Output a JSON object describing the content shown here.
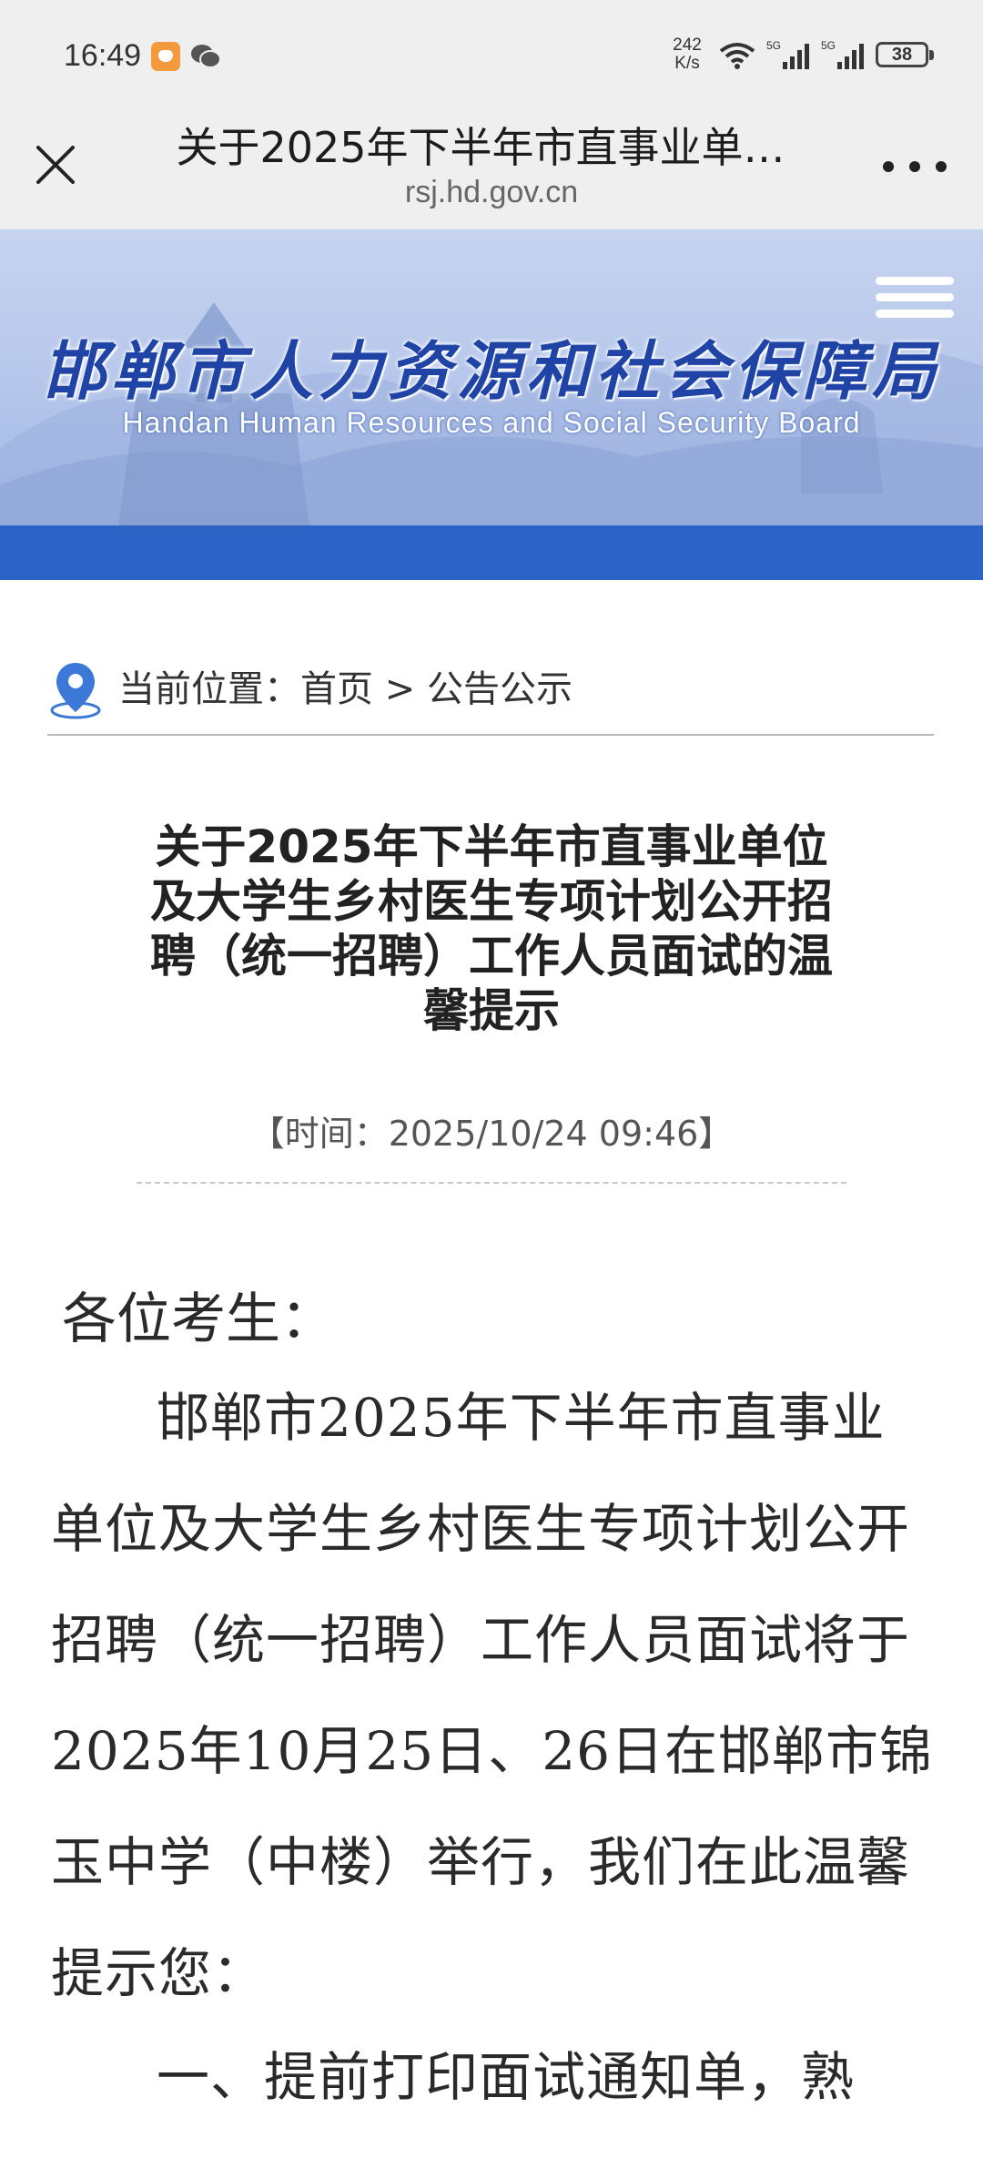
{
  "status_bar": {
    "time": "16:49",
    "net_speed_value": "242",
    "net_speed_unit": "K/s",
    "battery": "38",
    "icons": [
      "taobao-app-icon",
      "wechat-icon",
      "wifi-icon",
      "signal-5g-icon",
      "signal-5g-icon",
      "battery-icon"
    ]
  },
  "browser": {
    "title": "关于2025年下半年市直事业单…",
    "domain": "rsj.hd.gov.cn"
  },
  "banner": {
    "title_cn": "邯郸市人力资源和社会保障局",
    "title_en": "Handan Human Resources and Social Security Board"
  },
  "breadcrumb": {
    "text": "当前位置：首页 > 公告公示"
  },
  "article": {
    "title": "关于2025年下半年市直事业单位及大学生乡村医生专项计划公开招聘（统一招聘）工作人员面试的温馨提示",
    "time": "【时间：2025/10/24 09:46】",
    "salutation": "各位考生：",
    "paragraph1": "邯郸市2025年下半年市直事业单位及大学生乡村医生专项计划公开招聘（统一招聘）工作人员面试将于2025年10月25日、26日在邯郸市锦玉中学（中楼）举行，我们在此温馨提示您：",
    "paragraph2": "一、提前打印面试通知单，熟"
  },
  "colors": {
    "brand_blue": "#2c63c7",
    "banner_text": "#1f44a6"
  }
}
